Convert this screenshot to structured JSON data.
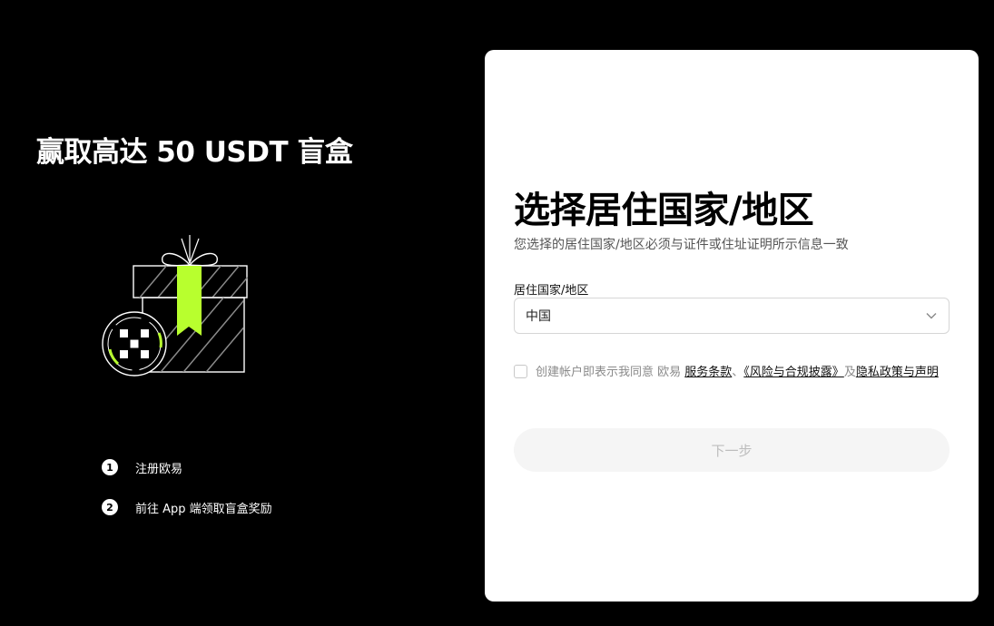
{
  "promo": {
    "title": "赢取高达 50 USDT 盲盒",
    "steps": [
      {
        "number": "1",
        "label": "注册欧易"
      },
      {
        "number": "2",
        "label": "前往 App 端领取盲盒奖励"
      }
    ],
    "accent_color": "#b8ff2e"
  },
  "form": {
    "title": "选择居住国家/地区",
    "subtitle": "您选择的居住国家/地区必须与证件或住址证明所示信息一致",
    "field_label": "居住国家/地区",
    "selected_country": "中国",
    "agreement": {
      "prefix": "创建帐户即表示我同意 欧易 ",
      "terms_link": "服务条款",
      "separator": "、",
      "risk_link": "《风险与合规披露》",
      "and_text": "及",
      "privacy_link": "隐私政策与声明",
      "checked": false
    },
    "next_button": "下一步"
  }
}
